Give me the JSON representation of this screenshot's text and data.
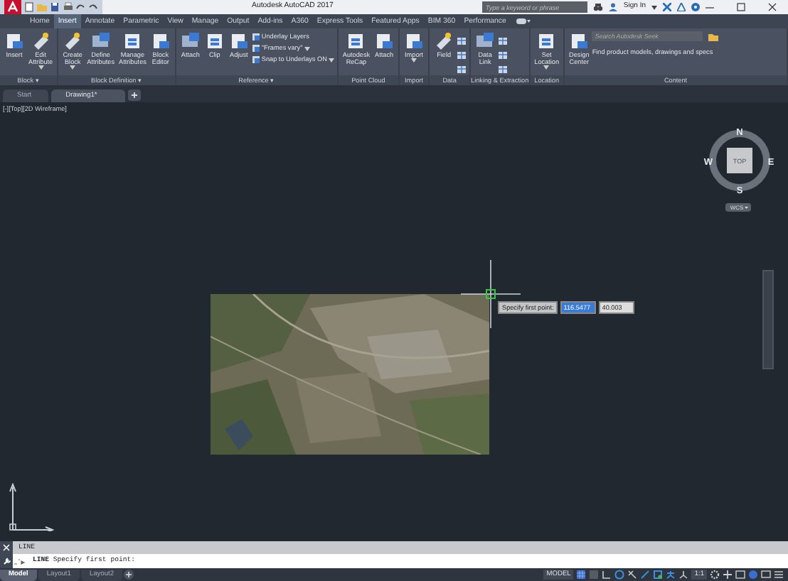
{
  "title_bar": {
    "title": "Autodesk AutoCAD 2017",
    "search": {
      "placeholder": "Type a keyword or phrase"
    },
    "sign_in": "Sign In"
  },
  "ribbon_tabs": [
    {
      "label": "Home",
      "selected": false
    },
    {
      "label": "Insert",
      "selected": true
    },
    {
      "label": "Annotate",
      "selected": false
    },
    {
      "label": "Parametric",
      "selected": false
    },
    {
      "label": "View",
      "selected": false
    },
    {
      "label": "Manage",
      "selected": false
    },
    {
      "label": "Output",
      "selected": false
    },
    {
      "label": "Add-ins",
      "selected": false
    },
    {
      "label": "A360",
      "selected": false
    },
    {
      "label": "Express Tools",
      "selected": false
    },
    {
      "label": "Featured Apps",
      "selected": false
    },
    {
      "label": "BIM 360",
      "selected": false
    },
    {
      "label": "Performance",
      "selected": false
    }
  ],
  "ribbon_panels": [
    {
      "title": "Block ▾",
      "buttons": [
        {
          "kind": "large",
          "label": "Insert",
          "menu": false
        },
        {
          "kind": "large",
          "label": "Edit\nAttribute",
          "menu": true
        }
      ]
    },
    {
      "title": "Block Definition ▾",
      "buttons": [
        {
          "kind": "large",
          "label": "Create\nBlock",
          "menu": true
        },
        {
          "kind": "large",
          "label": "Define\nAttributes",
          "menu": false
        },
        {
          "kind": "large",
          "label": "Manage\nAttributes",
          "menu": false
        },
        {
          "kind": "large",
          "label": "Block\nEditor",
          "menu": false
        }
      ]
    },
    {
      "title": "Reference ▾",
      "buttons": [
        {
          "kind": "large",
          "label": "Attach",
          "menu": false
        },
        {
          "kind": "large",
          "label": "Clip",
          "menu": false
        },
        {
          "kind": "large",
          "label": "Adjust",
          "menu": false
        },
        {
          "kind": "small",
          "label": "Underlay Layers",
          "menu": false
        },
        {
          "kind": "small",
          "label": "\"Frames vary\"",
          "menu": true
        },
        {
          "kind": "small",
          "label": "Snap to Underlays ON",
          "menu": true
        }
      ]
    },
    {
      "title": "Point Cloud",
      "buttons": [
        {
          "kind": "large",
          "label": "Autodesk\nReCap",
          "menu": false
        },
        {
          "kind": "large",
          "label": "Attach",
          "menu": false
        }
      ]
    },
    {
      "title": "Import",
      "buttons": [
        {
          "kind": "large",
          "label": "Import",
          "menu": true
        }
      ]
    },
    {
      "title": "Data",
      "buttons": [
        {
          "kind": "large",
          "label": "Field",
          "menu": false
        },
        {
          "kind": "icon"
        },
        {
          "kind": "icon"
        },
        {
          "kind": "icon"
        }
      ]
    },
    {
      "title": "Linking & Extraction",
      "buttons": [
        {
          "kind": "large",
          "label": "Data\nLink",
          "menu": false
        },
        {
          "kind": "icon"
        },
        {
          "kind": "icon"
        },
        {
          "kind": "icon"
        }
      ]
    },
    {
      "title": "Location",
      "buttons": [
        {
          "kind": "large",
          "label": "Set\nLocation",
          "menu": true
        }
      ]
    },
    {
      "title": "Content",
      "buttons": [
        {
          "kind": "large",
          "label": "Design\nCenter",
          "menu": false
        },
        {
          "kind": "seek",
          "placeholder": "Search Autodesk Seek",
          "note": "Find product models, drawings and specs"
        }
      ]
    }
  ],
  "file_tabs": [
    {
      "label": "Start",
      "selected": false
    },
    {
      "label": "Drawing1*",
      "selected": true
    }
  ],
  "viewport": {
    "label": "[-][Top][2D Wireframe]",
    "viewcube": {
      "north": "N",
      "south": "S",
      "east": "E",
      "west": "W",
      "face": "TOP",
      "ucs": "WCS"
    },
    "dynamic_input": {
      "prompt": "Specify first point:",
      "fields": [
        {
          "value": "116.5477",
          "selected": true
        },
        {
          "value": "40.003",
          "selected": false
        }
      ]
    }
  },
  "command_line": {
    "history": [
      "LINE"
    ],
    "input": "**LINE** Specify first point:"
  },
  "layout_tabs": [
    {
      "label": "Model",
      "selected": true
    },
    {
      "label": "Layout1",
      "selected": false
    },
    {
      "label": "Layout2",
      "selected": false
    }
  ],
  "status_bar": {
    "space": "MODEL",
    "scale": "1:1"
  }
}
